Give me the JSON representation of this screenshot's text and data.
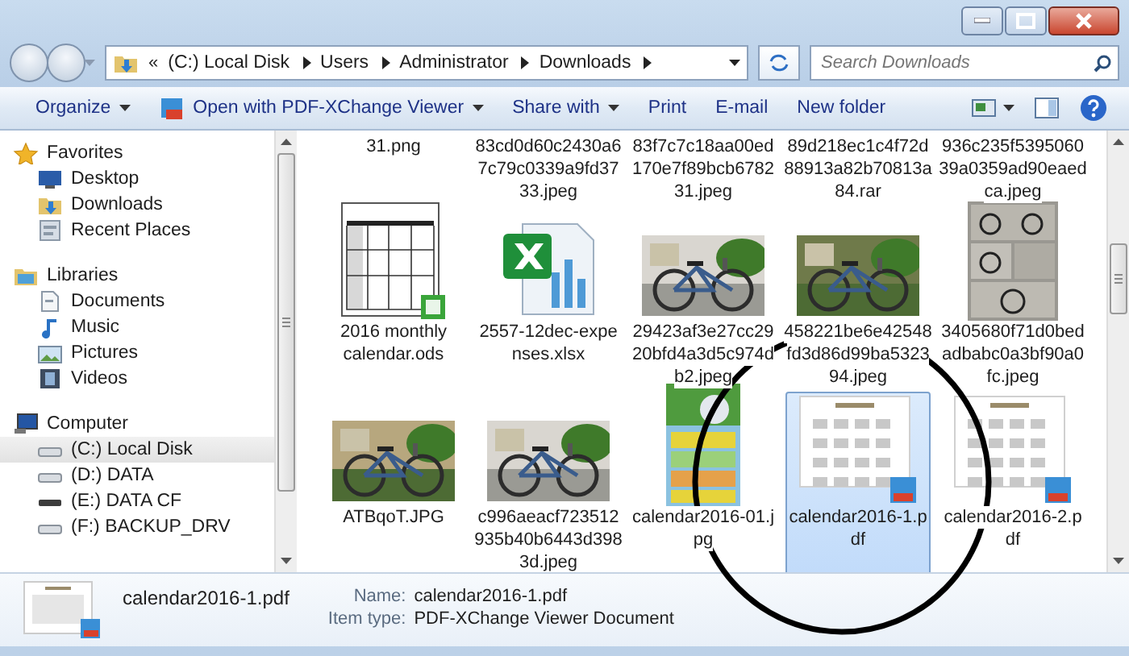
{
  "address": {
    "overflow": "«",
    "crumbs": [
      "(C:) Local Disk",
      "Users",
      "Administrator",
      "Downloads"
    ]
  },
  "search": {
    "placeholder": "Search Downloads"
  },
  "toolbar": [
    {
      "label": "Organize",
      "dropdown": true,
      "kind": "plain"
    },
    {
      "label": "Open with PDF-XChange Viewer",
      "dropdown": true,
      "kind": "app"
    },
    {
      "label": "Share with",
      "dropdown": true,
      "kind": "plain"
    },
    {
      "label": "Print",
      "dropdown": false,
      "kind": "plain"
    },
    {
      "label": "E-mail",
      "dropdown": false,
      "kind": "plain"
    },
    {
      "label": "New folder",
      "dropdown": false,
      "kind": "plain"
    }
  ],
  "sidebar": {
    "groups": [
      {
        "label": "Favorites",
        "kind": "favorites",
        "selected": false,
        "items": [
          {
            "label": "Desktop",
            "kind": "desktop",
            "selected": false
          },
          {
            "label": "Downloads",
            "kind": "downloads",
            "selected": false
          },
          {
            "label": "Recent Places",
            "kind": "recent",
            "selected": false
          }
        ]
      },
      {
        "label": "Libraries",
        "kind": "libraries",
        "selected": false,
        "items": [
          {
            "label": "Documents",
            "kind": "documents",
            "selected": false
          },
          {
            "label": "Music",
            "kind": "music",
            "selected": false
          },
          {
            "label": "Pictures",
            "kind": "pictures",
            "selected": false
          },
          {
            "label": "Videos",
            "kind": "videos",
            "selected": false
          }
        ]
      },
      {
        "label": "Computer",
        "kind": "computer",
        "selected": false,
        "items": [
          {
            "label": "(C:) Local Disk",
            "kind": "disk",
            "selected": true
          },
          {
            "label": "(D:) DATA",
            "kind": "disk",
            "selected": false
          },
          {
            "label": "(E:) DATA CF",
            "kind": "drive",
            "selected": false
          },
          {
            "label": "(F:) BACKUP_DRV",
            "kind": "disk",
            "selected": false
          }
        ]
      }
    ]
  },
  "files": [
    [
      {
        "kind": "cut",
        "selected": false,
        "lines": [
          "31.png"
        ]
      },
      {
        "kind": "cut",
        "selected": false,
        "lines": [
          "83cd0d60c2430a6",
          "7c79c0339a9fd37",
          "33.jpeg"
        ]
      },
      {
        "kind": "cut",
        "selected": false,
        "lines": [
          "83f7c7c18aa00ed",
          "170e7f89bcb6782",
          "31.jpeg"
        ]
      },
      {
        "kind": "cut",
        "selected": false,
        "lines": [
          "89d218ec1c4f72d",
          "88913a82b70813a",
          "84.rar"
        ]
      },
      {
        "kind": "cut",
        "selected": false,
        "lines": [
          "936c235f5395060",
          "39a0359ad90eaed",
          "ca.jpeg"
        ]
      }
    ],
    [
      {
        "kind": "calendar",
        "selected": false,
        "lines": [
          "2016 monthly",
          "calendar.ods"
        ]
      },
      {
        "kind": "spreadsheet",
        "selected": false,
        "lines": [
          "2557-12dec-expe",
          "nses.xlsx"
        ]
      },
      {
        "kind": "picture",
        "selected": false,
        "lines": [
          "29423af3e27cc29",
          "20bfd4a3d5c974d",
          "b2.jpeg"
        ]
      },
      {
        "kind": "picture",
        "selected": false,
        "lines": [
          "458221be6e42548",
          "fd3d86d99ba5323",
          "94.jpeg"
        ]
      },
      {
        "kind": "collage",
        "selected": false,
        "lines": [
          "3405680f71d0bed",
          "adbabc0a3bf90a0",
          "fc.jpeg"
        ]
      }
    ],
    [
      {
        "kind": "picture",
        "selected": false,
        "lines": [
          "ATBqoT.JPG"
        ]
      },
      {
        "kind": "picture",
        "selected": false,
        "lines": [
          "c996aeacf723512",
          "935b40b6443d398",
          "3d.jpeg"
        ]
      },
      {
        "kind": "poster",
        "selected": false,
        "lines": [
          "calendar2016-01.j",
          "pg"
        ]
      },
      {
        "kind": "pdf",
        "selected": true,
        "lines": [
          "calendar2016-1.p",
          "df"
        ]
      },
      {
        "kind": "pdf",
        "selected": false,
        "lines": [
          "calendar2016-2.p",
          "df"
        ]
      }
    ]
  ],
  "details": {
    "title": "calendar2016-1.pdf",
    "fields": [
      {
        "label": "Name:",
        "value": "calendar2016-1.pdf"
      },
      {
        "label": "Item type:",
        "value": "PDF-XChange Viewer Document"
      }
    ]
  }
}
